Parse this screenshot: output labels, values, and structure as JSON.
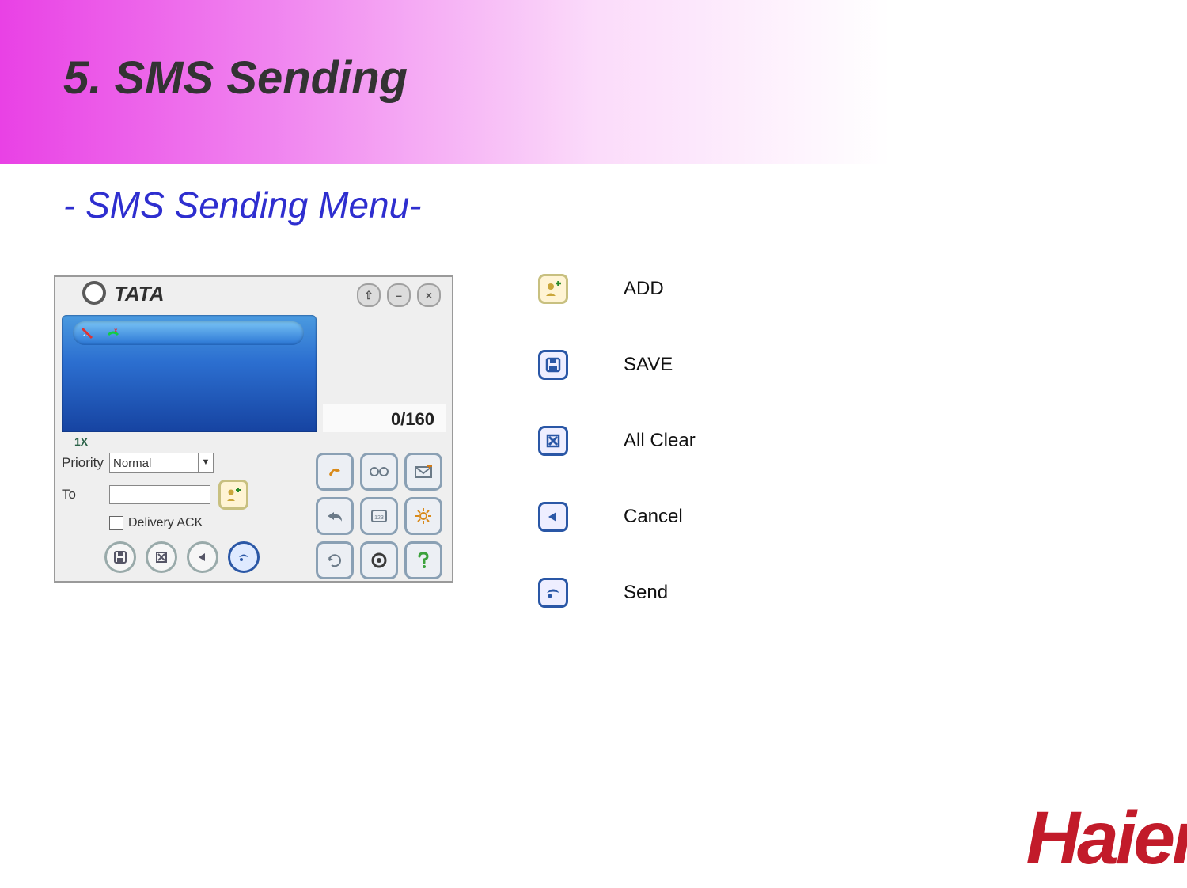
{
  "header": {
    "title": "5. SMS Sending",
    "subtitle": "- SMS Sending Menu-"
  },
  "app": {
    "brand": "TATA",
    "counter": "0/160",
    "signal_label": "1X",
    "form": {
      "priority_label": "Priority",
      "priority_value": "Normal",
      "to_label": "To",
      "to_value": "",
      "delivery_ack_label": "Delivery ACK"
    },
    "win": {
      "pin": "⇧",
      "min": "–",
      "close": "×"
    }
  },
  "legend": [
    {
      "key": "add",
      "label": "ADD"
    },
    {
      "key": "save",
      "label": "SAVE"
    },
    {
      "key": "allclear",
      "label": "All Clear"
    },
    {
      "key": "cancel",
      "label": "Cancel"
    },
    {
      "key": "send",
      "label": "Send"
    }
  ],
  "footer": {
    "brand": "Haier"
  }
}
